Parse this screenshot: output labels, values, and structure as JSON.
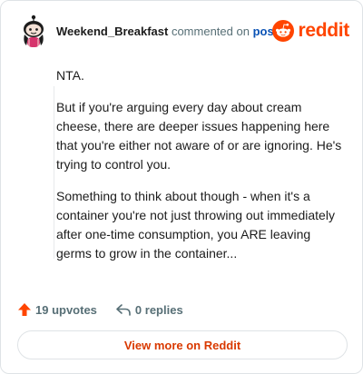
{
  "header": {
    "username": "Weekend_Breakfast",
    "action_text": "commented on",
    "post_link": "post",
    "brand_name": "reddit",
    "avatar_icon": "snoo-avatar-icon",
    "brand_icon": "reddit-logo-icon"
  },
  "comment": {
    "paragraphs": [
      "NTA.",
      "But if you're arguing every day about cream cheese, there are deeper issues happening here that you're either not aware of or are ignoring. He's trying to control you.",
      "Something to think about though - when it's a container you're not just throwing out immediately after one-time consumption, you ARE leaving germs to grow in the container..."
    ]
  },
  "stats": {
    "upvotes": "19 upvotes",
    "replies": "0 replies",
    "upvote_icon": "upvote-arrow-icon",
    "reply_icon": "reply-arrow-icon"
  },
  "footer": {
    "view_more": "View more on Reddit"
  },
  "colors": {
    "brand": "#ff4500",
    "link": "#0a52b5",
    "view_more": "#d93900",
    "muted": "#576f76"
  }
}
